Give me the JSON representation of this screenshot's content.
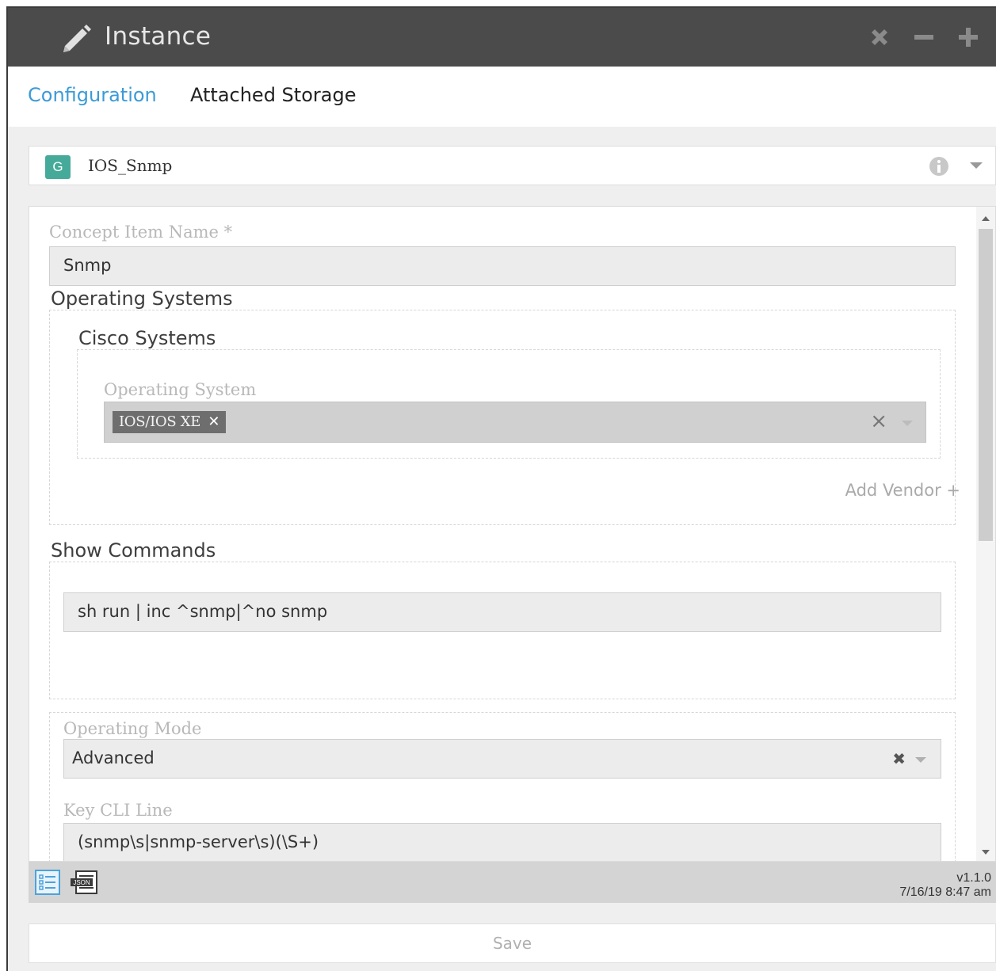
{
  "window": {
    "title": "Instance",
    "buttons": [
      "close",
      "minimize",
      "maximize"
    ]
  },
  "tabs": [
    {
      "label": "Configuration",
      "active": true
    },
    {
      "label": "Attached Storage",
      "active": false
    }
  ],
  "group": {
    "badge": "G",
    "name": "IOS_Snmp"
  },
  "form": {
    "concept_item_name": {
      "label": "Concept Item Name *",
      "value": "Snmp"
    },
    "operating_systems": {
      "title": "Operating Systems",
      "vendor": "Cisco Systems",
      "os_label": "Operating System",
      "os_selected": "IOS/IOS XE",
      "add_vendor": "Add Vendor +"
    },
    "show_commands": {
      "title": "Show Commands",
      "value": "sh run | inc ^snmp|^no snmp"
    },
    "operating_mode": {
      "label": "Operating Mode",
      "value": "Advanced"
    },
    "key_cli_line": {
      "label": "Key CLI Line",
      "value": "(snmp\\s|snmp-server\\s)(\\S+)"
    }
  },
  "footer": {
    "version": "v1.1.0",
    "timestamp": "7/16/19 8:47 am"
  },
  "save_label": "Save",
  "colors": {
    "titlebar": "#4b4b4b",
    "accent": "#3b9bd6",
    "badge": "#46aa9a"
  }
}
